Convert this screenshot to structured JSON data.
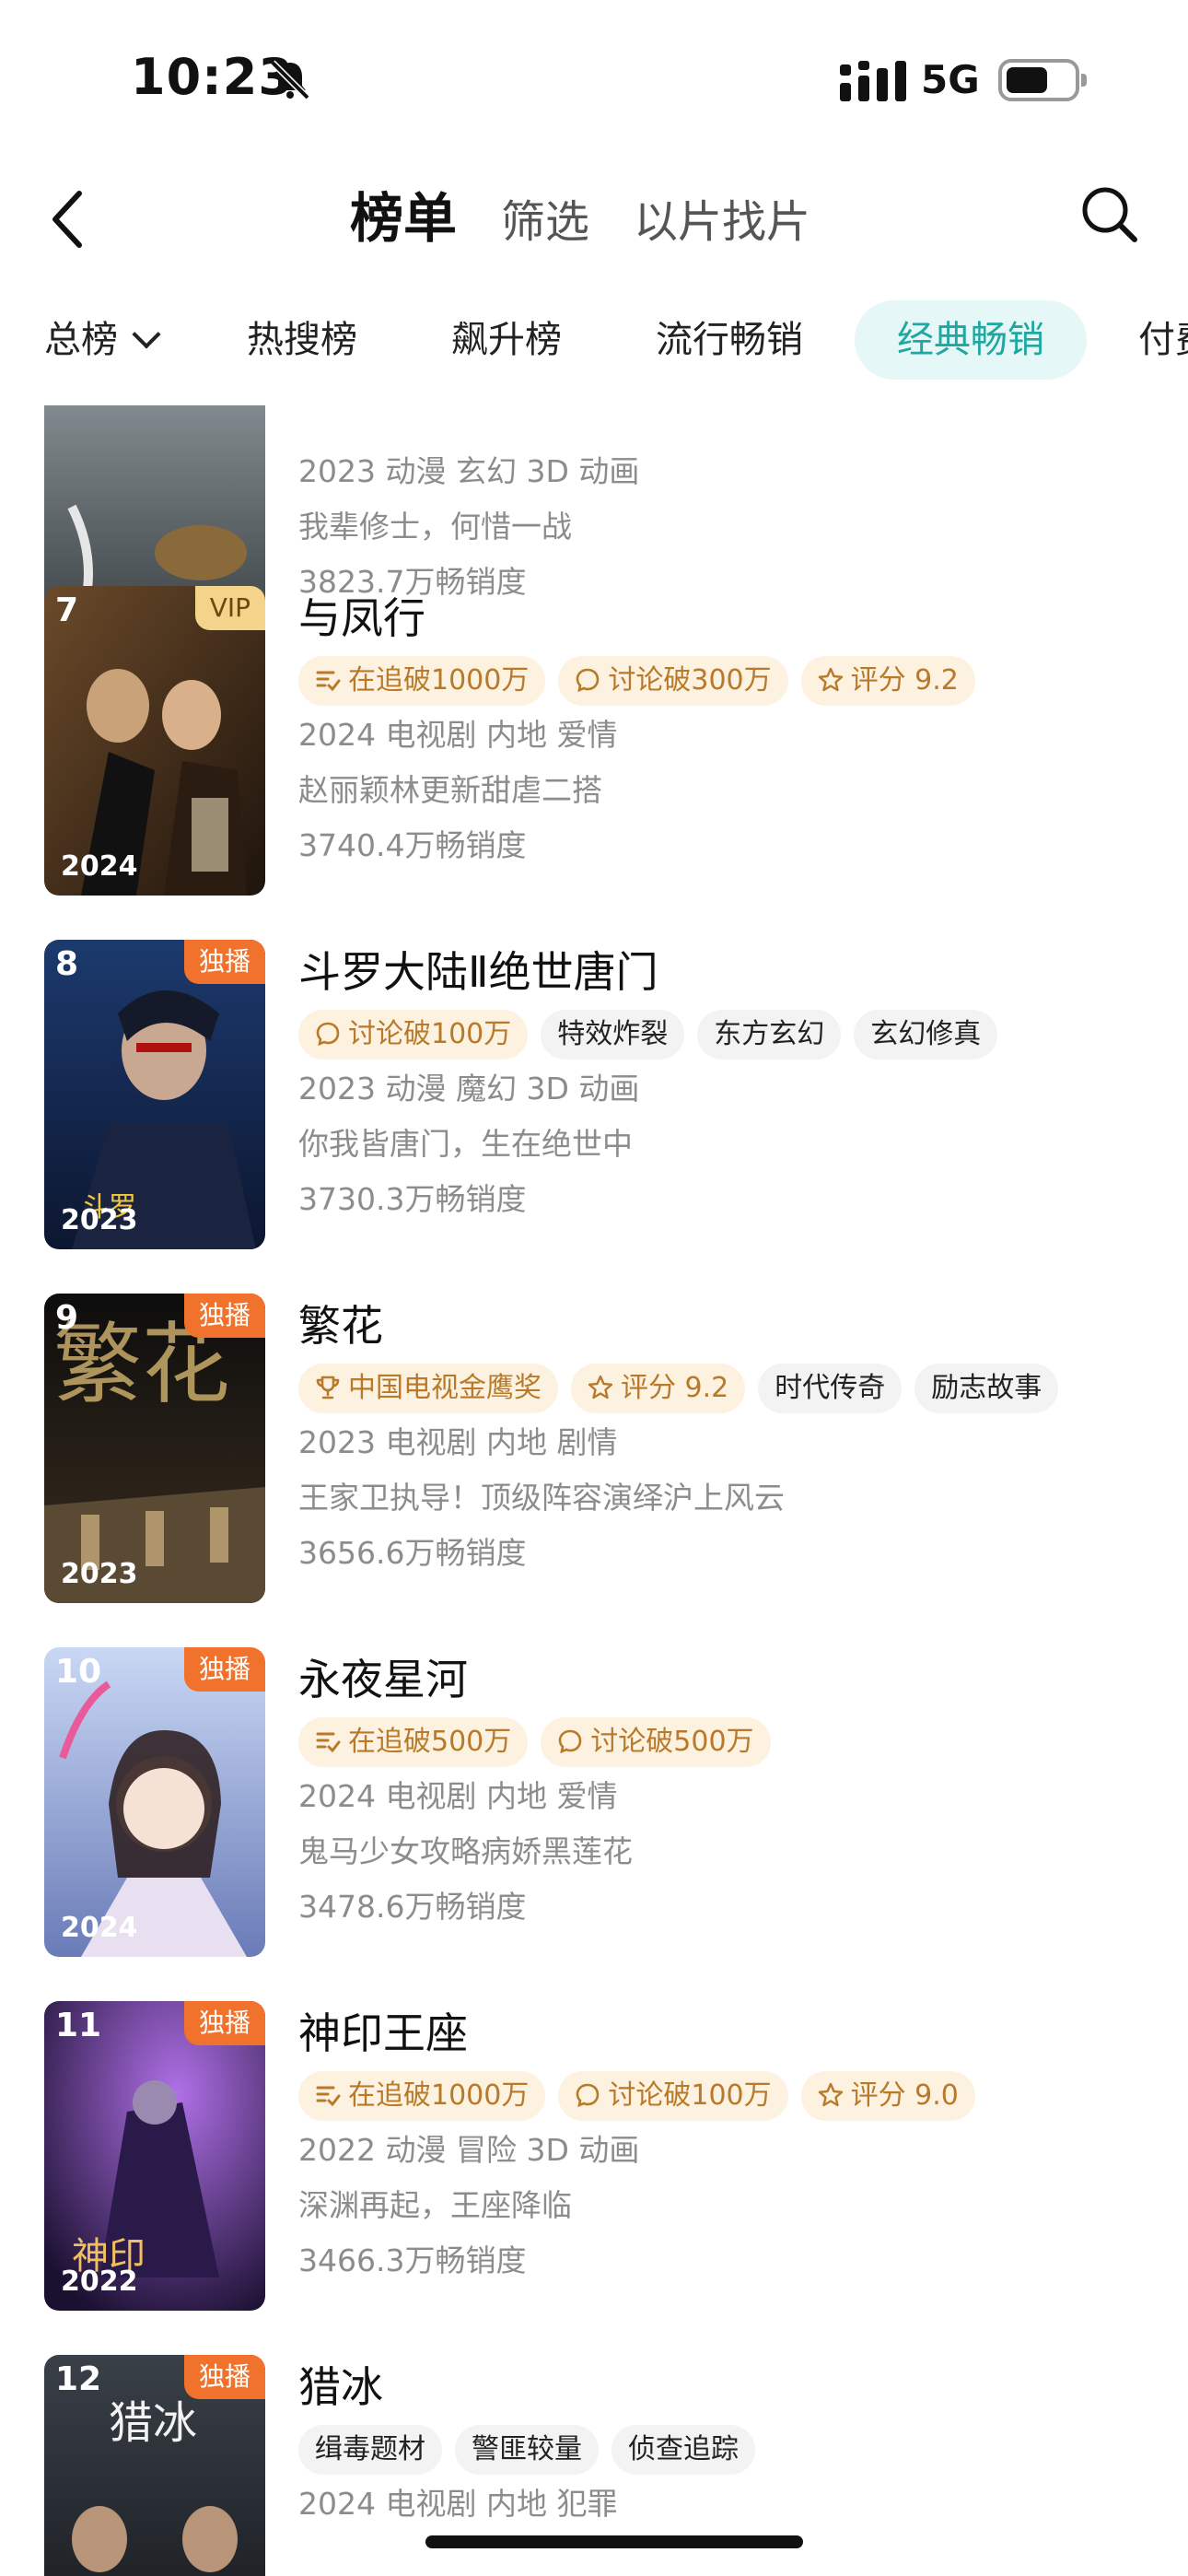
{
  "status_bar": {
    "time": "10:23",
    "network": "5G"
  },
  "header": {
    "tabs": [
      {
        "label": "榜单",
        "active": true
      },
      {
        "label": "筛选",
        "active": false
      },
      {
        "label": "以片找片",
        "active": false
      }
    ]
  },
  "categories": [
    {
      "label": "总榜",
      "active": false
    },
    {
      "label": "热搜榜",
      "active": false
    },
    {
      "label": "飙升榜",
      "active": false
    },
    {
      "label": "流行畅销",
      "active": false
    },
    {
      "label": "经典畅销",
      "active": true
    },
    {
      "label": "付费",
      "active": false
    }
  ],
  "colors": {
    "accent": "#1fa7a0",
    "accent_bg": "#e5f7f6",
    "tag_gold_text": "#b87a2a",
    "tag_gold_bg": "#fdf1df",
    "exclusive_badge": "#f0722d",
    "vip_badge": "#f4d38a"
  },
  "items": [
    {
      "rank": "",
      "badge": "",
      "year": "2023",
      "title": "",
      "tags": [],
      "line1": "2023 动漫 玄幻 3D 动画",
      "line2": "我辈修士，何惜一战",
      "sales": "3823.7万畅销度"
    },
    {
      "rank": "7",
      "badge": "VIP",
      "year": "2024",
      "title": "与凤行",
      "tags": [
        {
          "icon": "list-check-icon",
          "text": "在追破1000万",
          "style": "gold"
        },
        {
          "icon": "chat-bubble-icon",
          "text": "讨论破300万",
          "style": "gold"
        },
        {
          "icon": "star-icon",
          "text": "评分 9.2",
          "style": "gold"
        }
      ],
      "line1": "2024 电视剧 内地 爱情",
      "line2": "赵丽颖林更新甜虐二搭",
      "sales": "3740.4万畅销度"
    },
    {
      "rank": "8",
      "badge": "独播",
      "year": "2023",
      "title": "斗罗大陆Ⅱ绝世唐门",
      "tags": [
        {
          "icon": "chat-bubble-icon",
          "text": "讨论破100万",
          "style": "gold"
        },
        {
          "icon": "",
          "text": "特效炸裂",
          "style": "plain"
        },
        {
          "icon": "",
          "text": "东方玄幻",
          "style": "plain"
        },
        {
          "icon": "",
          "text": "玄幻修真",
          "style": "plain"
        }
      ],
      "line1": "2023 动漫 魔幻 3D 动画",
      "line2": "你我皆唐门，生在绝世中",
      "sales": "3730.3万畅销度"
    },
    {
      "rank": "9",
      "badge": "独播",
      "year": "2023",
      "title": "繁花",
      "tags": [
        {
          "icon": "trophy-icon",
          "text": "中国电视金鹰奖",
          "style": "gold"
        },
        {
          "icon": "star-icon",
          "text": "评分 9.2",
          "style": "gold"
        },
        {
          "icon": "",
          "text": "时代传奇",
          "style": "plain"
        },
        {
          "icon": "",
          "text": "励志故事",
          "style": "plain"
        }
      ],
      "line1": "2023 电视剧 内地 剧情",
      "line2": "王家卫执导！顶级阵容演绎沪上风云",
      "sales": "3656.6万畅销度"
    },
    {
      "rank": "10",
      "badge": "独播",
      "year": "2024",
      "title": "永夜星河",
      "tags": [
        {
          "icon": "list-check-icon",
          "text": "在追破500万",
          "style": "gold"
        },
        {
          "icon": "chat-bubble-icon",
          "text": "讨论破500万",
          "style": "gold"
        }
      ],
      "line1": "2024 电视剧 内地 爱情",
      "line2": "鬼马少女攻略病娇黑莲花",
      "sales": "3478.6万畅销度"
    },
    {
      "rank": "11",
      "badge": "独播",
      "year": "2022",
      "title": "神印王座",
      "tags": [
        {
          "icon": "list-check-icon",
          "text": "在追破1000万",
          "style": "gold"
        },
        {
          "icon": "chat-bubble-icon",
          "text": "讨论破100万",
          "style": "gold"
        },
        {
          "icon": "star-icon",
          "text": "评分 9.0",
          "style": "gold"
        }
      ],
      "line1": "2022 动漫 冒险 3D 动画",
      "line2": "深渊再起，王座降临",
      "sales": "3466.3万畅销度"
    },
    {
      "rank": "12",
      "badge": "独播",
      "year": "",
      "title": "猎冰",
      "tags": [
        {
          "icon": "",
          "text": "缉毒题材",
          "style": "plain"
        },
        {
          "icon": "",
          "text": "警匪较量",
          "style": "plain"
        },
        {
          "icon": "",
          "text": "侦查追踪",
          "style": "plain"
        }
      ],
      "line1": "2024 电视剧 内地 犯罪",
      "line2": "",
      "sales": ""
    }
  ]
}
